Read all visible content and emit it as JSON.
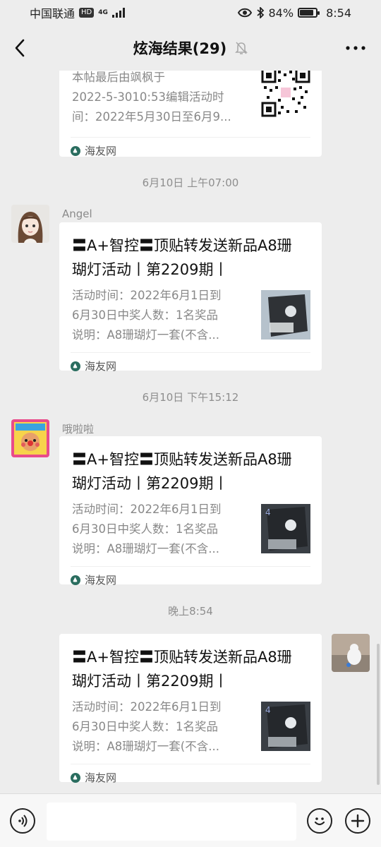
{
  "status_bar": {
    "carrier": "中国联通",
    "hd": "HD",
    "network": "4G",
    "battery": "84%",
    "battery_level": 0.84,
    "time": "8:54"
  },
  "header": {
    "title": "炫海结果(29)",
    "back_icon": "chevron-left-icon",
    "mute_icon": "bell-muted-icon",
    "more_icon": "more-icon"
  },
  "messages": [
    {
      "title_visible": "",
      "desc": "本帖最后由飒枫于2022-5-3010:53编辑活动时间：2022年5月30日至6月9...",
      "desc_lines": [
        "本帖最后由飒枫于",
        "2022-5-3010:53编辑活动时",
        "间：2022年5月30日至6月9..."
      ],
      "source": "海友网"
    },
    {
      "time": "6月10日 上午07:00",
      "sender": "Angel",
      "title": "〓A+智控〓顶贴转发送新品A8珊瑚灯活动丨第2209期丨",
      "title_lines": [
        "〓A+智控〓顶贴转发送新品A8珊",
        "瑚灯活动丨第2209期丨"
      ],
      "desc_lines": [
        "活动时间：2022年6月1日到",
        "6月30日中奖人数：1名奖品",
        "说明：A8珊瑚灯一套(不含..."
      ],
      "source": "海友网"
    },
    {
      "time": "6月10日 下午15:12",
      "sender": "哦啦啦",
      "title_lines": [
        "〓A+智控〓顶贴转发送新品A8珊",
        "瑚灯活动丨第2209期丨"
      ],
      "desc_lines": [
        "活动时间：2022年6月1日到",
        "6月30日中奖人数：1名奖品",
        "说明：A8珊瑚灯一套(不含..."
      ],
      "source": "海友网"
    },
    {
      "time": "晚上8:54",
      "title_lines": [
        "〓A+智控〓顶贴转发送新品A8珊",
        "瑚灯活动丨第2209期丨"
      ],
      "desc_lines": [
        "活动时间：2022年6月1日到",
        "6月30日中奖人数：1名奖品",
        "说明：A8珊瑚灯一套(不含..."
      ],
      "source": "海友网"
    }
  ],
  "input_bar": {
    "voice_icon": "voice-icon",
    "emoji_icon": "emoji-icon",
    "plus_icon": "plus-icon",
    "placeholder": ""
  }
}
